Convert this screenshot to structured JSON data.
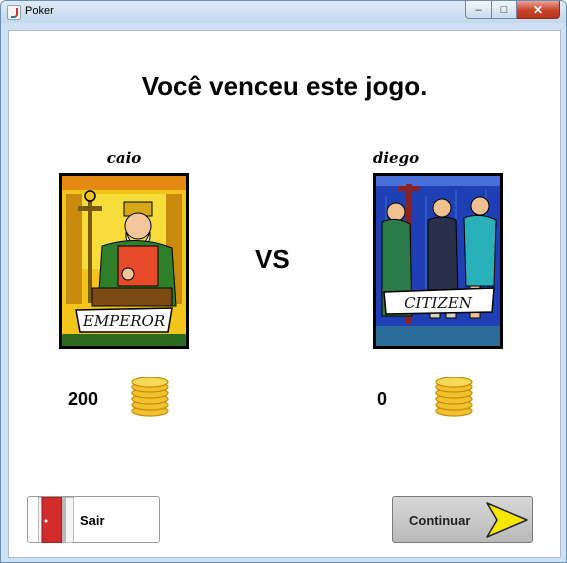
{
  "window": {
    "title": "Poker",
    "controls": {
      "minimize": "‒",
      "maximize": "□",
      "close": "✕"
    }
  },
  "headline": "Você venceu este jogo.",
  "vs_label": "VS",
  "players": [
    {
      "name": "caio",
      "card_label": "EMPEROR",
      "chips": "200",
      "card_colors": {
        "bg": "#f3c41a",
        "frame": "#000000"
      }
    },
    {
      "name": "diego",
      "card_label": "CITIZEN",
      "chips": "0",
      "card_colors": {
        "bg": "#1f3fb5",
        "frame": "#000000"
      }
    }
  ],
  "buttons": {
    "exit_label": "Sair",
    "continue_label": "Continuar"
  },
  "colors": {
    "coin": "#f2c12e",
    "arrow": "#f6e600",
    "door": "#d22b2b"
  },
  "icons": {
    "coins": "gold-coins-icon",
    "door": "exit-door-icon",
    "arrow": "arrow-right-icon"
  }
}
